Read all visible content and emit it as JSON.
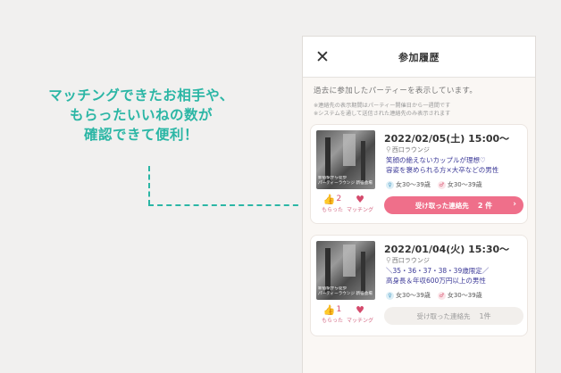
{
  "annotation": {
    "lines": [
      "マッチングできたお相手や、",
      "もらったいいねの数が",
      "確認できて便利！"
    ]
  },
  "header": {
    "title": "参加履歴",
    "close_icon": "close-icon"
  },
  "intro": {
    "main": "過去に参加したパーティーを表示しています。",
    "note1": "※連絡先の表示期間はパーティー開催日から一週間です",
    "note2": "※システムを通して送信された連絡先のみ表示されます"
  },
  "cards": [
    {
      "date": "2022/02/05(土) 15:00〜",
      "venue": "西口ラウンジ",
      "desc1": "笑顔の絶えないカップルが理想♡",
      "desc2": "容姿を褒められる方×大卒などの男性",
      "age_female": "女30〜39歳",
      "age_male": "女30〜39歳",
      "likes": "2",
      "likes_label": "もらった",
      "match_label": "マッチング",
      "thumb_text1": "新宿駅から徒歩",
      "thumb_text2": "パーティーラウンジ 新宿会場",
      "button_label": "受け取った連絡先",
      "button_count": "2 件",
      "button_state": "active"
    },
    {
      "date": "2022/01/04(火) 15:30〜",
      "venue": "西口ラウンジ",
      "desc1": "＼35・36・37・38・39歳限定／",
      "desc2": "高身長＆年収600万円以上の男性",
      "age_female": "女30〜39歳",
      "age_male": "女30〜39歳",
      "likes": "1",
      "likes_label": "もらった",
      "match_label": "マッチング",
      "thumb_text1": "新宿駅から徒歩",
      "thumb_text2": "パーティーラウンジ 新宿会場",
      "button_label": "受け取った連絡先",
      "button_count": "1件",
      "button_state": "disabled"
    }
  ],
  "colors": {
    "accent": "#2bb6a5",
    "pink": "#ef6f8a",
    "desc": "#3c3a98"
  }
}
